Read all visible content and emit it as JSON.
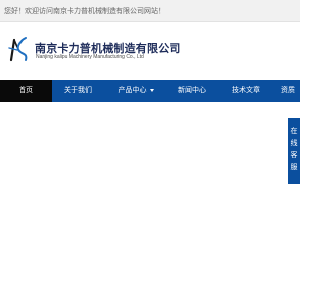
{
  "topbar": {
    "greeting": "您好！欢迎访问南京卡力普机械制造有限公司网站！"
  },
  "brand": {
    "name_cn": "南京卡力普机械制造有限公司",
    "name_en": "Nanjing kalipu Machinery Manufacturing Co., Ltd",
    "logo_colors": {
      "blue": "#1f6fc0",
      "black": "#1a1a1a"
    }
  },
  "nav": {
    "items": [
      {
        "label": "首页",
        "active": true
      },
      {
        "label": "关于我们",
        "active": false
      },
      {
        "label": "产品中心",
        "active": false,
        "has_dropdown": true
      },
      {
        "label": "新闻中心",
        "active": false
      },
      {
        "label": "技术文章",
        "active": false
      },
      {
        "label": "资质",
        "active": false
      }
    ],
    "background": "#0b4f9e",
    "active_background": "#0a0a0a"
  },
  "side_service": {
    "chars": [
      "在",
      "线",
      "客",
      "服"
    ]
  }
}
